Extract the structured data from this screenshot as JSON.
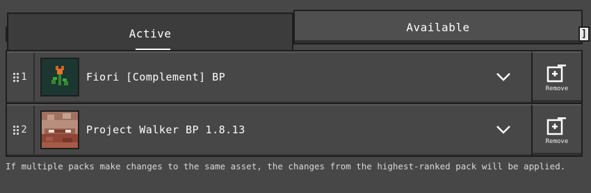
{
  "tabs": [
    {
      "label": "Active",
      "selected": true
    },
    {
      "label": "Available",
      "selected": false
    }
  ],
  "bracket_left": "[",
  "bracket_right": "]",
  "packs": [
    {
      "rank": "1",
      "name": "Fiori [Complement] BP",
      "remove_label": "Remove",
      "icon": "tulip-pack-icon"
    },
    {
      "rank": "2",
      "name": "Project Walker BP 1.8.13",
      "remove_label": "Remove",
      "icon": "walker-face-pack-icon"
    }
  ],
  "footer": {
    "message": "If multiple packs make changes to the same asset, the changes from the highest-ranked pack will be applied."
  },
  "colors": {
    "background": "#474747",
    "border": "#1e1e1e",
    "text": "#ffffff"
  }
}
